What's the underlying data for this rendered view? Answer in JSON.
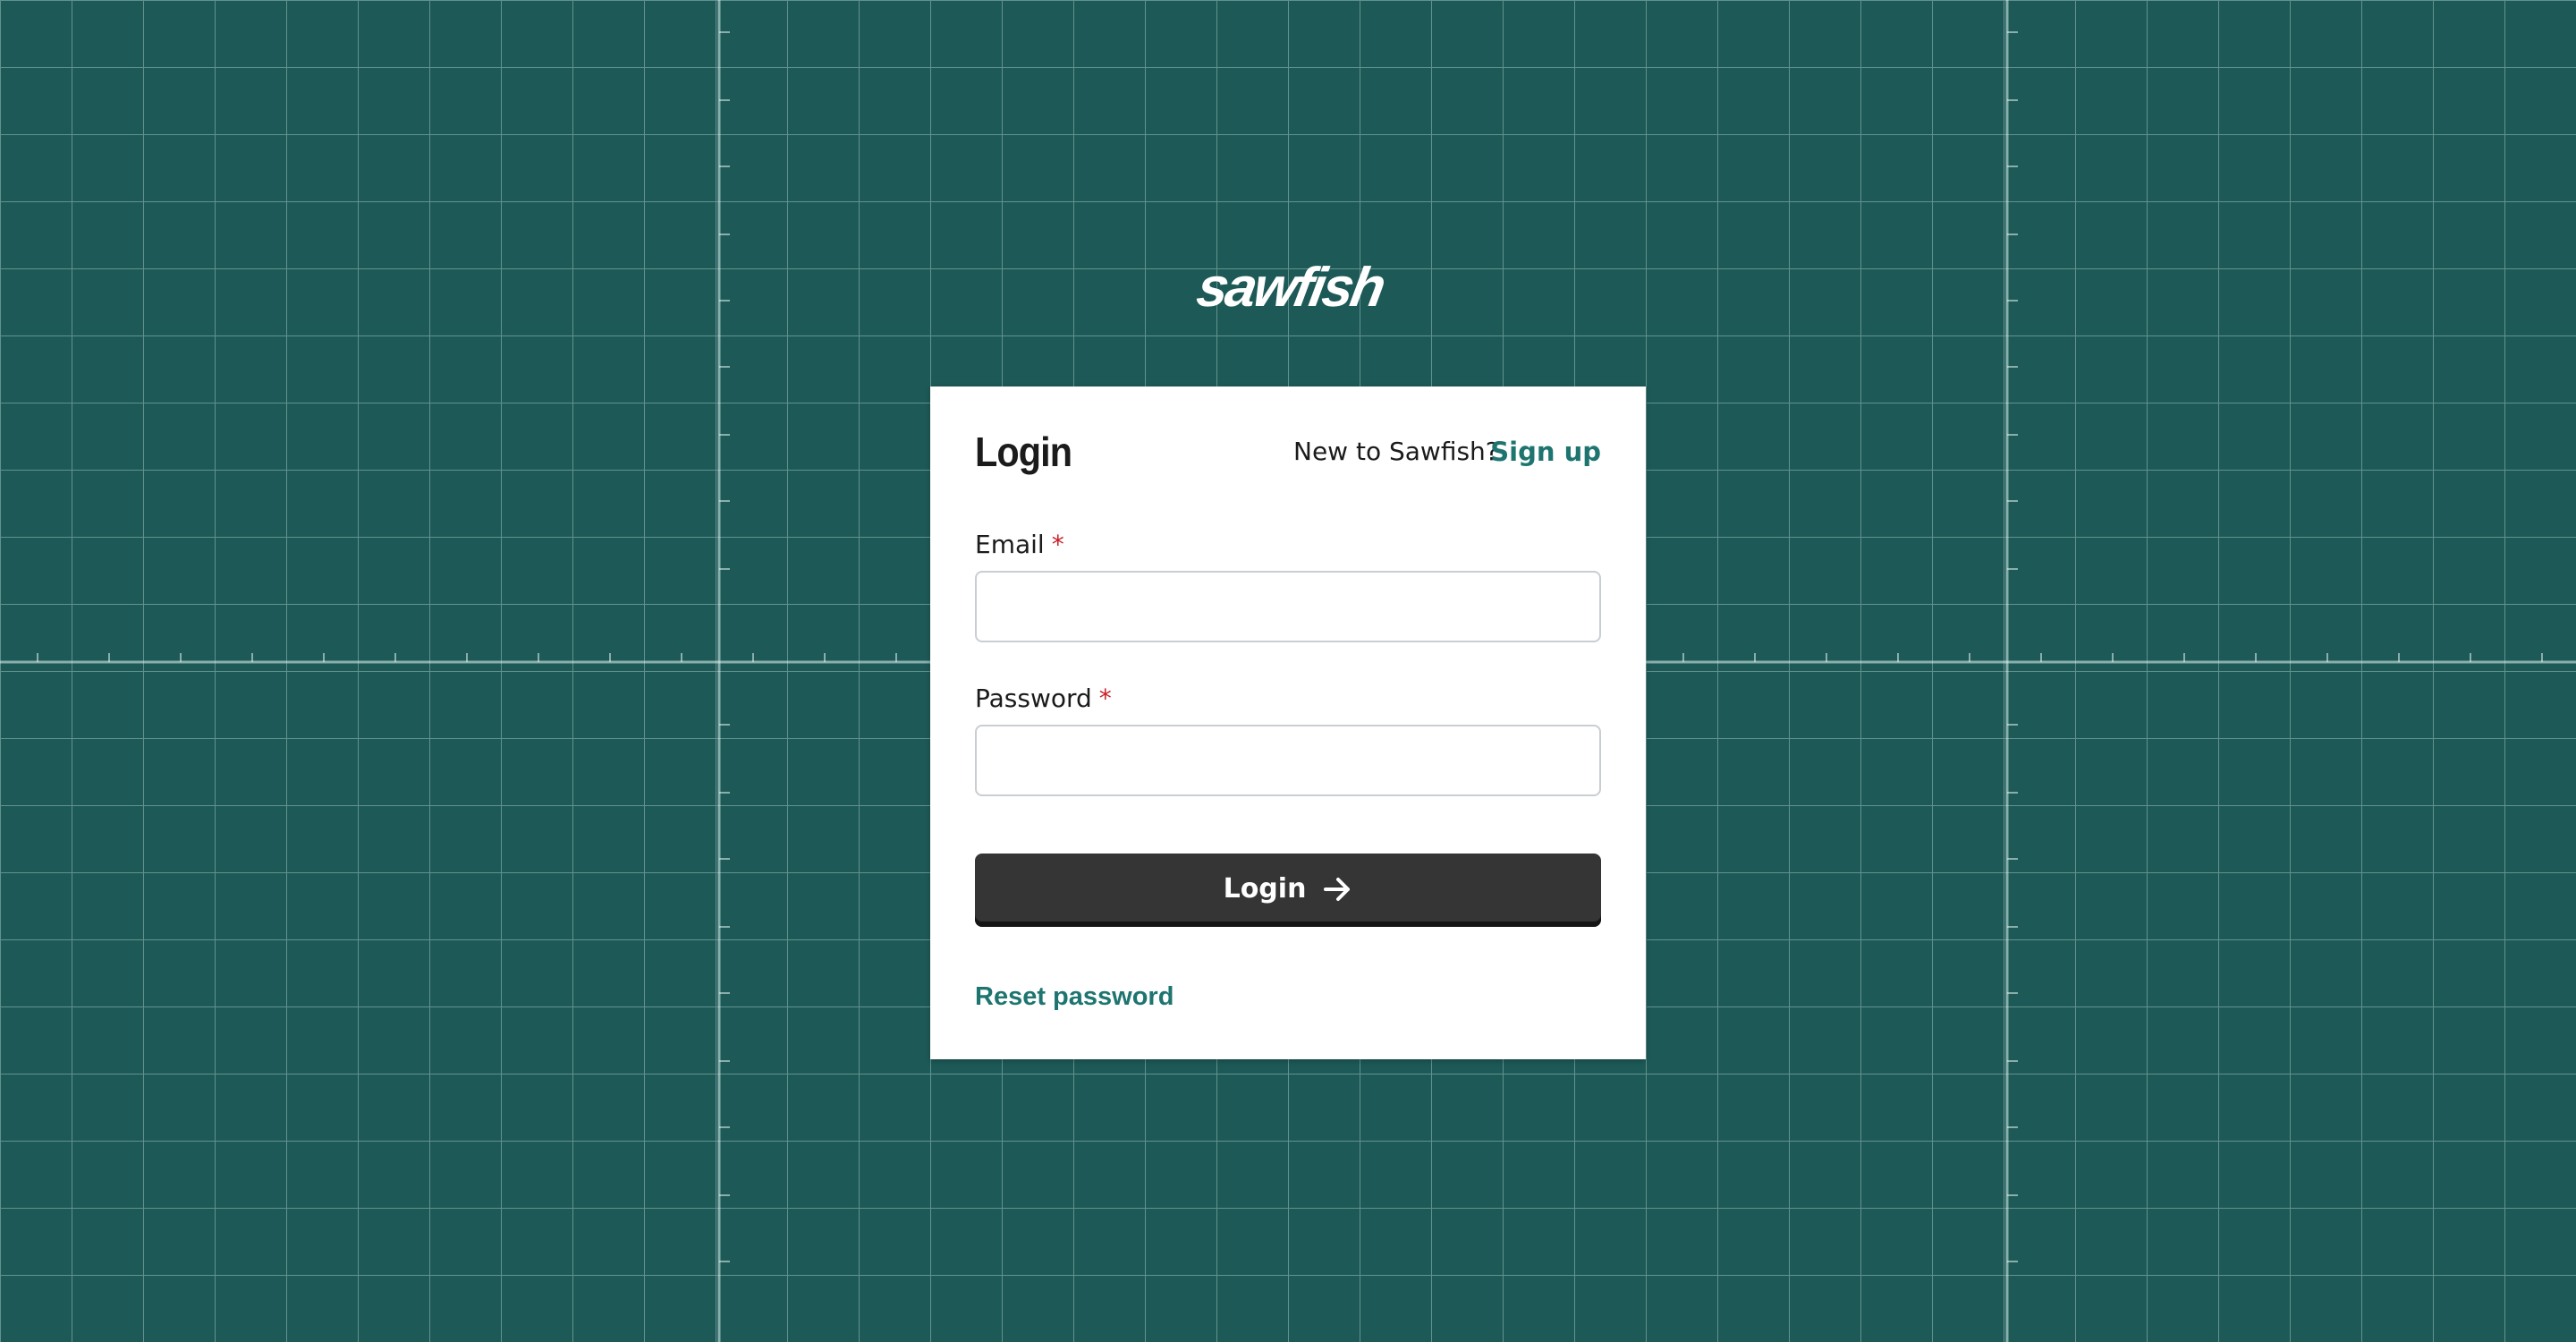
{
  "brand": {
    "logo_text": "sawfish",
    "colors": {
      "background": "#1d5a57",
      "accent": "#1e7570",
      "button": "#353535",
      "required": "#c8202a"
    }
  },
  "login_card": {
    "title": "Login",
    "signup_prompt": "New to Sawfish?",
    "signup_link": "Sign up",
    "email": {
      "label": "Email",
      "required_marker": "*",
      "value": "",
      "placeholder": ""
    },
    "password": {
      "label": "Password",
      "required_marker": "*",
      "value": "",
      "placeholder": ""
    },
    "submit": {
      "label": "Login",
      "icon": "arrow-right-icon"
    },
    "reset_link": "Reset password"
  }
}
